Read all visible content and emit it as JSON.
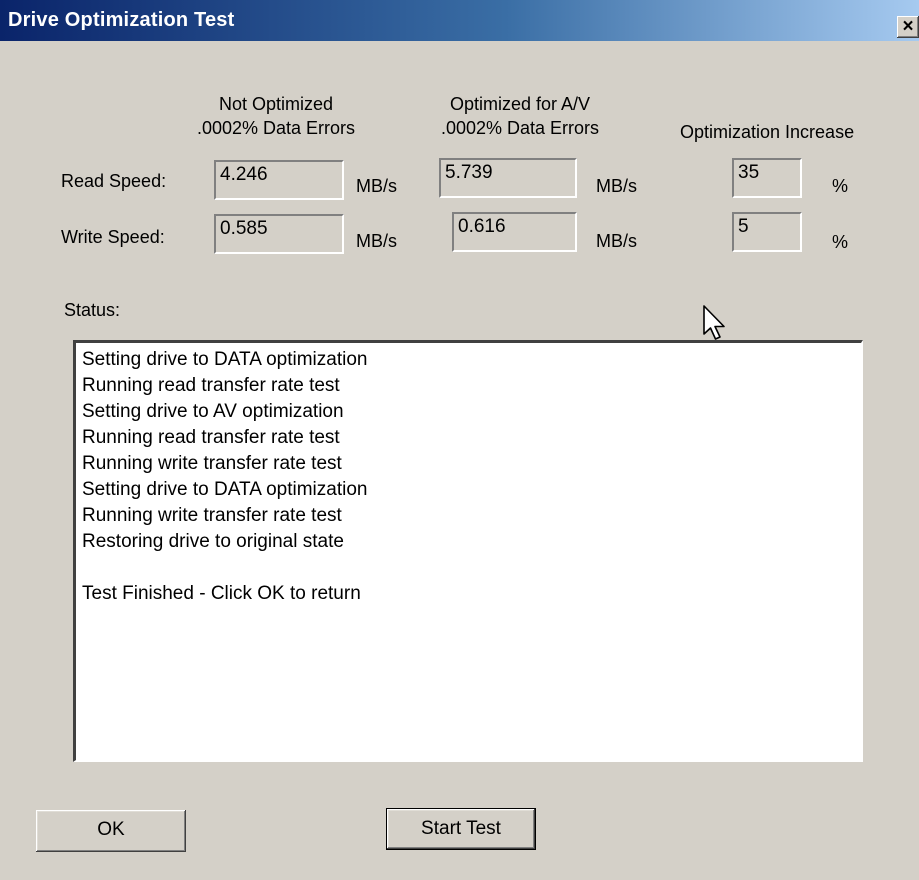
{
  "window": {
    "title": "Drive Optimization Test",
    "close_glyph": "×"
  },
  "headers": {
    "not_optimized": "Not Optimized",
    "not_optimized_sub": ".0002% Data Errors",
    "optimized": "Optimized for A/V",
    "optimized_sub": ".0002% Data Errors",
    "increase": "Optimization Increase"
  },
  "rows": {
    "read": {
      "label": "Read Speed:",
      "not_optimized": "4.246",
      "optimized": "5.739",
      "increase": "35"
    },
    "write": {
      "label": "Write Speed:",
      "not_optimized": "0.585",
      "optimized": "0.616",
      "increase": "5"
    }
  },
  "units": {
    "speed": "MB/s",
    "percent": "%"
  },
  "status": {
    "label": "Status:",
    "lines": [
      "Setting drive to DATA optimization",
      "Running read transfer rate test",
      "Setting drive to AV optimization",
      "Running read transfer rate test",
      "Running write transfer rate test",
      "Setting drive to DATA optimization",
      "Running write transfer rate test",
      "Restoring drive to original state",
      "",
      "Test Finished - Click OK to return"
    ]
  },
  "buttons": {
    "ok": "OK",
    "start_test": "Start Test"
  },
  "icons": {
    "cursor": "mouse-pointer-icon"
  }
}
